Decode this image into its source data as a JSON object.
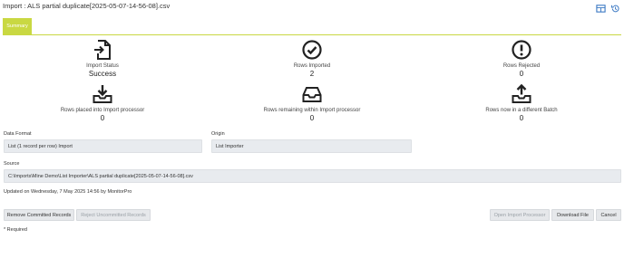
{
  "title": "Import : ALS partial duplicate[2025-05-07-14-56-08].csv",
  "tabs": [
    {
      "label": "Summary"
    }
  ],
  "header_icons": [
    "grid-icon",
    "history-icon"
  ],
  "stats": [
    {
      "label": "Import Status",
      "value": "Success",
      "icon": "file-import-icon"
    },
    {
      "label": "Rows Imported",
      "value": "2",
      "icon": "check-circle-icon"
    },
    {
      "label": "Rows Rejected",
      "value": "0",
      "icon": "exclamation-circle-icon"
    },
    {
      "label": "Rows placed into Import processor",
      "value": "0",
      "icon": "download-tray-icon"
    },
    {
      "label": "Rows remaining within Import processor",
      "value": "0",
      "icon": "inbox-tray-icon"
    },
    {
      "label": "Rows now in a different Batch",
      "value": "0",
      "icon": "upload-tray-icon"
    }
  ],
  "fields": {
    "data_format": {
      "label": "Data Format",
      "value": "List (1 record per row) Import"
    },
    "origin": {
      "label": "Origin",
      "value": "List Importer"
    },
    "source": {
      "label": "Source",
      "value": "C:\\Imports\\Mine Demo\\List Importer\\ALS partial duplicate[2025-05-07-14-56-08].csv"
    }
  },
  "updated_text": "Updated on Wednesday, 7 May 2025 14:56 by MonitorPro",
  "buttons": {
    "remove_committed": "Remove Committed Records",
    "reject_uncommitted": "Reject Uncommitted Records",
    "open_import_processor": "Open Import Processor",
    "download_file": "Download File",
    "cancel": "Cancel"
  },
  "required_note": "* Required",
  "colors": {
    "accent": "#c9d842",
    "field_bg": "#e8ebef",
    "icon": "#222222",
    "header_icon": "#3a78c3"
  }
}
